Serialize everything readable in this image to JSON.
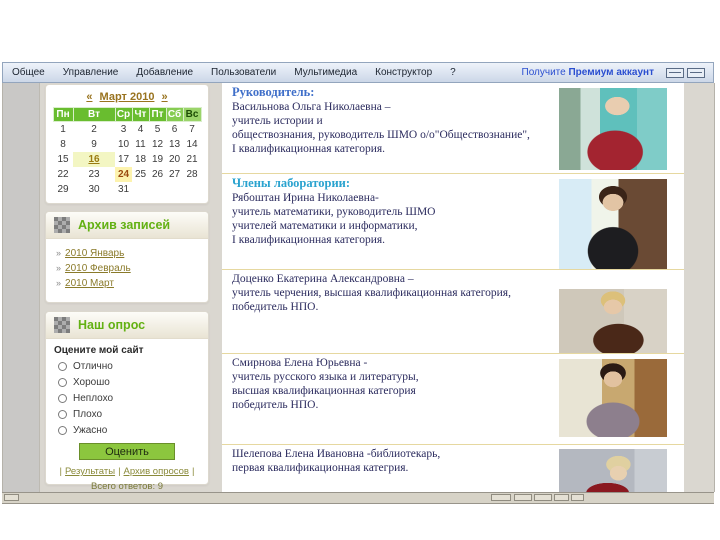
{
  "admin_bar": {
    "menu_items": [
      "Общее",
      "Управление",
      "Добавление",
      "Пользователи",
      "Мультимедиа",
      "Конструктор",
      "?"
    ],
    "premium_text": "Получите",
    "premium_bold": "Премиум аккаунт"
  },
  "calendar": {
    "prev_arrow": "«",
    "title": "Март 2010",
    "next_arrow": "»",
    "weekdays": [
      "Пн",
      "Вт",
      "Ср",
      "Чт",
      "Пт",
      "Сб",
      "Вс"
    ],
    "weeks": [
      [
        "1",
        "2",
        "3",
        "4",
        "5",
        "6",
        "7"
      ],
      [
        "8",
        "9",
        "10",
        "11",
        "12",
        "13",
        "14"
      ],
      [
        "15",
        "16",
        "17",
        "18",
        "19",
        "20",
        "21"
      ],
      [
        "22",
        "23",
        "24",
        "25",
        "26",
        "27",
        "28"
      ],
      [
        "29",
        "30",
        "31",
        "",
        "",
        "",
        ""
      ]
    ],
    "linked_day": "16",
    "current_day": "24"
  },
  "archive": {
    "title": "Архив записей",
    "bullet": "»",
    "items": [
      "2010 Январь",
      "2010 Февраль",
      "2010 Март"
    ]
  },
  "poll": {
    "title": "Наш опрос",
    "question": "Оцените мой сайт",
    "options": [
      "Отлично",
      "Хорошо",
      "Неплохо",
      "Плохо",
      "Ужасно"
    ],
    "button_label": "Оценить",
    "separator": "|",
    "links": [
      "Результаты",
      "Архив опросов"
    ],
    "total_answers": "Всего ответов: 9"
  },
  "content": {
    "sections": [
      {
        "heading": "Руководитель:",
        "lines": [
          "Васильнова Ольга Николаевна  –",
          "учитель истории и",
          "обществознания, руководитель ШМО о/о\"Обществознание\",",
          "I квалификационная категория."
        ],
        "photo": "teacher-in-red-sweater"
      },
      {
        "heading": "Члены лаборатории:",
        "lines": [
          "Рябоштан Ирина Николаевна-",
          "учитель математики, руководитель ШМО",
          "учителей математики и информатики,",
          "I квалификационная категория."
        ],
        "photo": "teacher-in-black"
      },
      {
        "heading": "",
        "lines": [
          "Доценко Екатерина Александровна –",
          "учитель черчения, высшая квалификационная категория,",
          "победитель   НПО."
        ],
        "photo": "teacher-in-brown"
      },
      {
        "heading": "",
        "lines": [
          "Смирнова Елена Юрьевна -",
          "учитель русского языка и литературы,",
          "высшая квалификационная категория",
          "победитель   НПО."
        ],
        "photo": "teacher-in-floral-blouse"
      },
      {
        "heading": "",
        "lines": [
          "Шелепова Елена Ивановна  -библиотекарь,",
          "первая квалификационная категрия."
        ],
        "photo": "librarian"
      }
    ]
  },
  "colors": {
    "accent_green": "#8cc63e",
    "calendar_header_green": "#69bd2f",
    "heading_blue": "#3f6fc9",
    "heading_teal": "#2aa3cf",
    "link_olive": "#99731f",
    "divider_tan": "#e6d8a0",
    "admin_bar_blue": "#ccd7e8"
  }
}
